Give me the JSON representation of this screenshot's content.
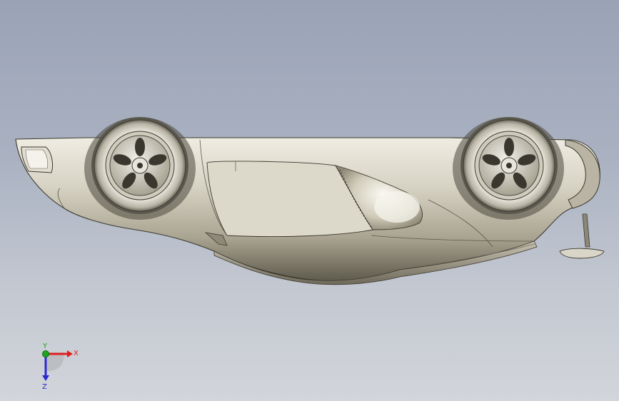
{
  "viewport": {
    "background_top": "#9aa3b6",
    "background_bottom": "#d2d5da",
    "model_color": "#c9c4b3"
  },
  "triad": {
    "x_label": "X",
    "y_label": "Y",
    "z_label": "Z",
    "x_color": "#e02020",
    "y_color": "#1fa51f",
    "z_color": "#2a2ad0"
  }
}
